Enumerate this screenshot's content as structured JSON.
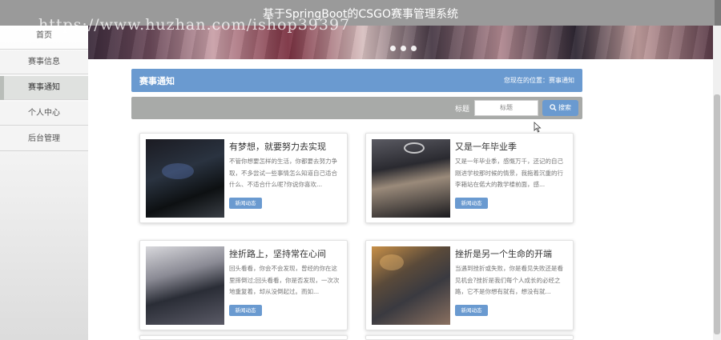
{
  "app": {
    "title": "基于SpringBoot的CSGO赛事管理系统"
  },
  "watermark": "https://www.huzhan.com/ishop39397",
  "sidebar": {
    "items": [
      {
        "label": "首页"
      },
      {
        "label": "赛事信息"
      },
      {
        "label": "赛事通知",
        "active": true
      },
      {
        "label": "个人中心"
      },
      {
        "label": "后台管理"
      }
    ]
  },
  "section": {
    "title": "赛事通知",
    "breadcrumb": "您现在的位置：赛事通知"
  },
  "search": {
    "label": "标题",
    "placeholder": "标题",
    "button": "搜索"
  },
  "cards": [
    {
      "title": "有梦想，就要努力去实现",
      "desc": "不管你想要怎样的生活，你都要去努力争取，不多尝试一些事情怎么知道自己适合什么、不适合什么呢?你说你喜欢...",
      "tag": "新闻动态"
    },
    {
      "title": "又是一年毕业季",
      "desc": "又是一年毕业季，感慨万千，还记的自己刚进学校那时候的情景，我拖着沉重的行李箱站在偌大的教学楼前面，感...",
      "tag": "新闻动态"
    },
    {
      "title": "挫折路上，坚持常在心间",
      "desc": "回头看看，你会不会发现，曾经的你在这里摔倒过;回头看看，你是否发现，一次次地重复着，却从没倒起过。而如...",
      "tag": "新闻动态"
    },
    {
      "title": "挫折是另一个生命的开端",
      "desc": "当遇到挫折或失败，你是看见失败还是看见机会?挫折是我们每个人成长的必经之路，它不是你想有就有，想没有就...",
      "tag": "新闻动态"
    }
  ]
}
